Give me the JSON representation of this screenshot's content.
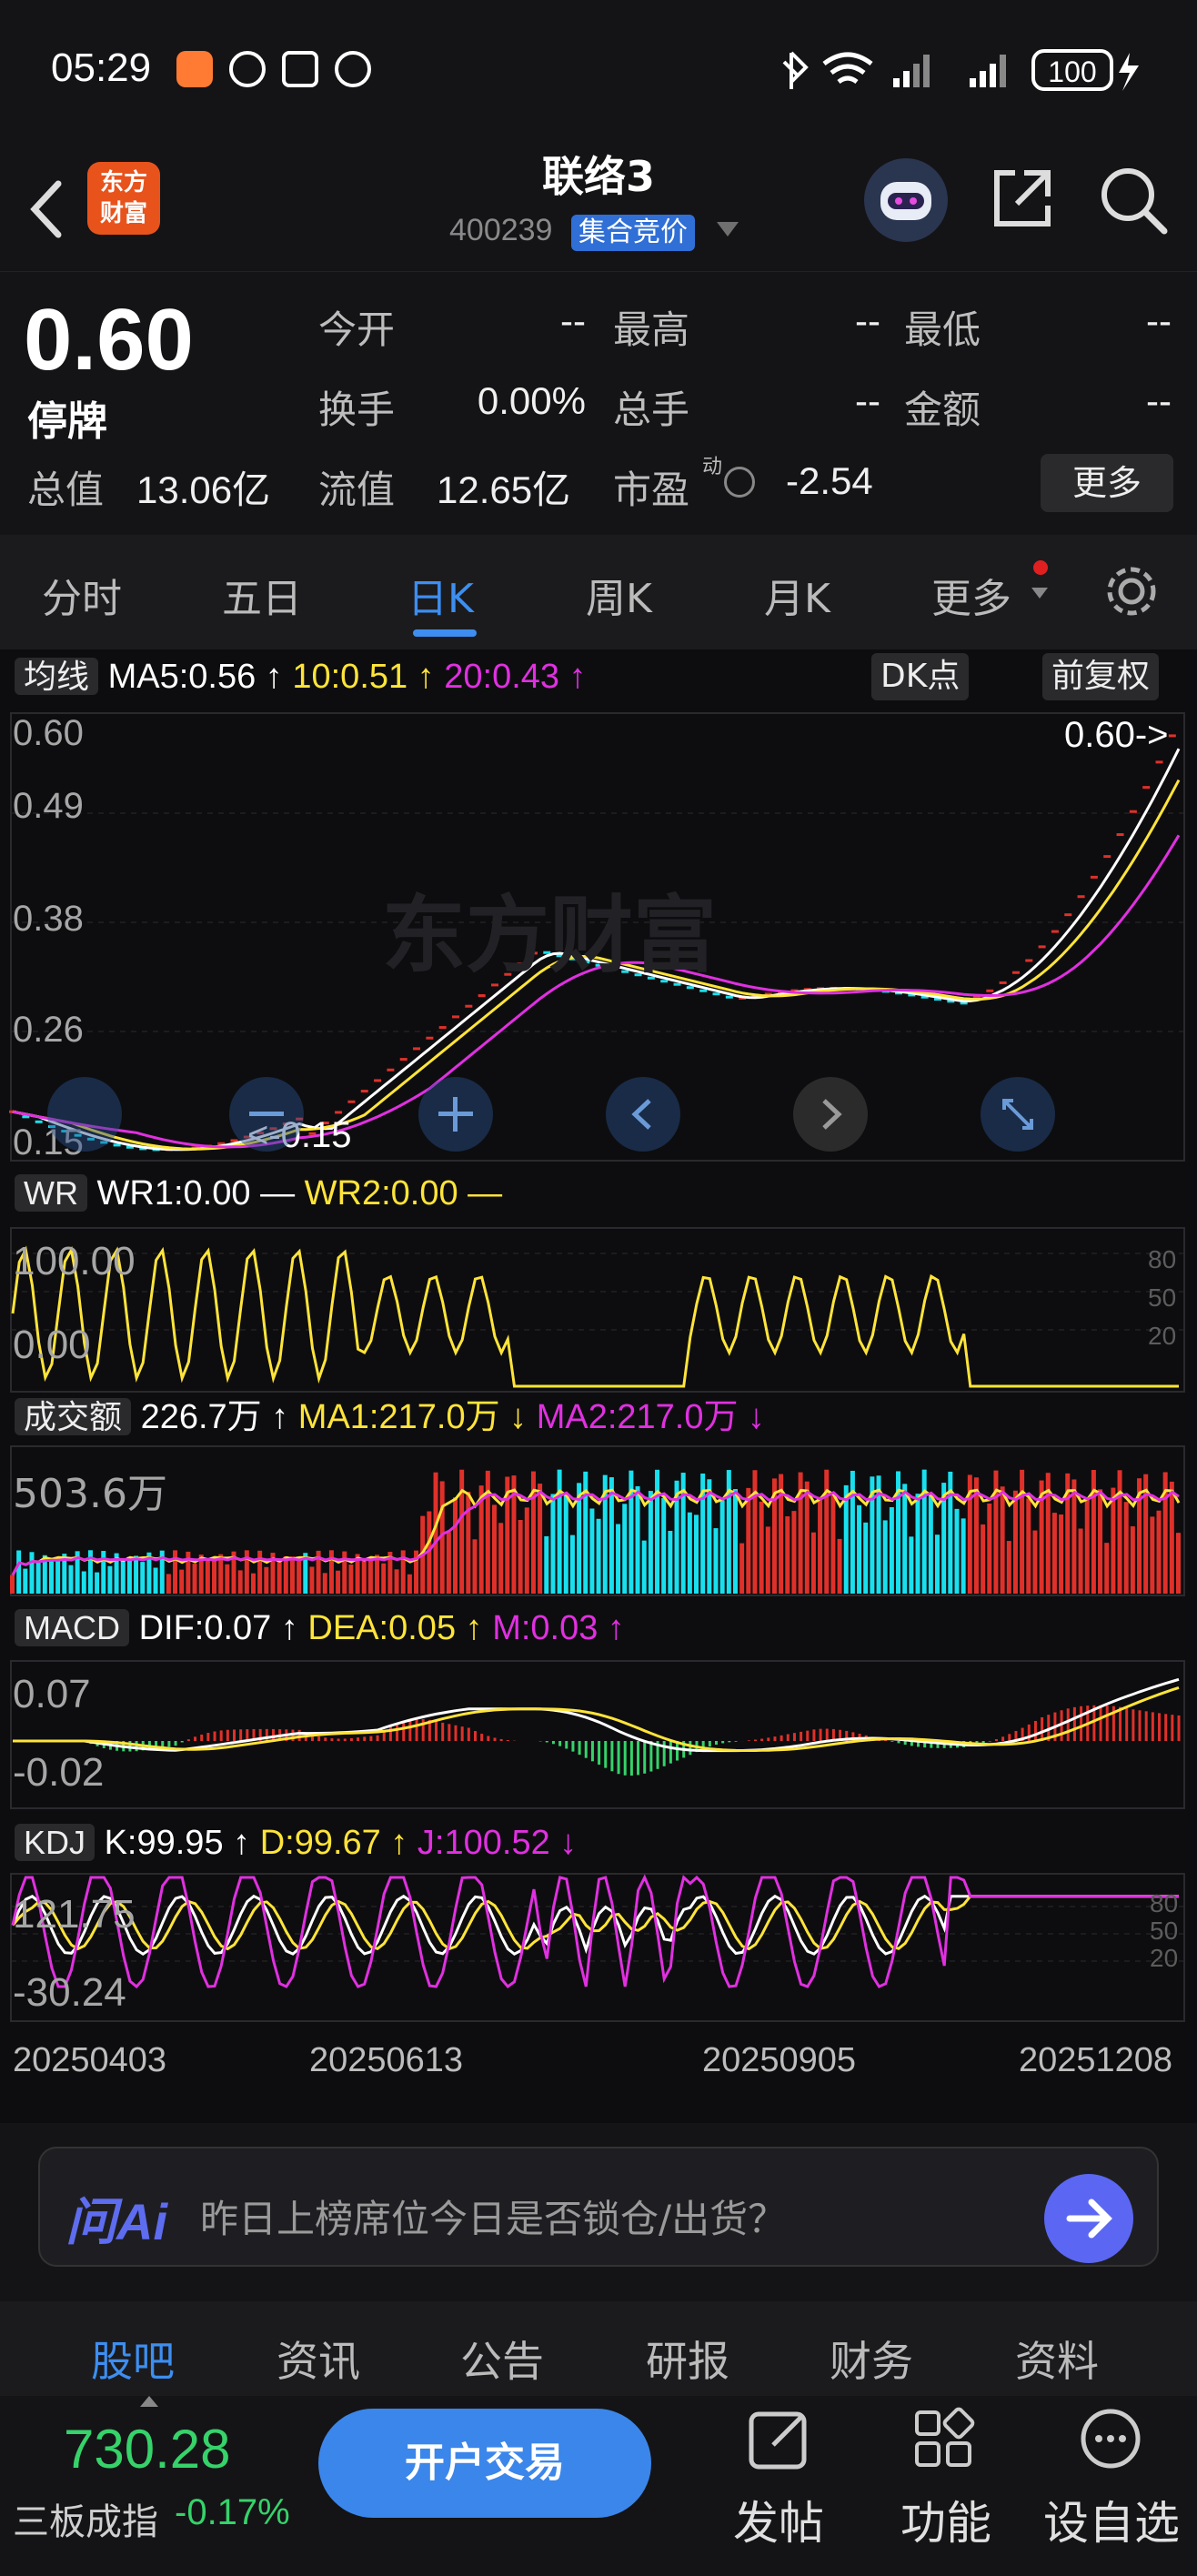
{
  "status": {
    "time": "05:29",
    "battery": "100"
  },
  "header": {
    "title": "联络3",
    "code": "400239",
    "badge": "集合竞价",
    "logo_text": [
      "东方",
      "财富"
    ]
  },
  "quote": {
    "price": "0.60",
    "state": "停牌",
    "rows": [
      [
        {
          "l": "今开",
          "v": "--"
        },
        {
          "l": "最高",
          "v": "--"
        },
        {
          "l": "最低",
          "v": "--"
        }
      ],
      [
        {
          "l": "换手",
          "v": "0.00%"
        },
        {
          "l": "总手",
          "v": "--"
        },
        {
          "l": "金额",
          "v": "--"
        }
      ]
    ],
    "total_label": "总值",
    "total_value": "13.06亿",
    "float_label": "流值",
    "float_value": "12.65亿",
    "pe_label": "市盈",
    "pe_sup": "动",
    "pe_value": "-2.54",
    "more_label": "更多"
  },
  "tabs": [
    "分时",
    "五日",
    "日K",
    "周K",
    "月K",
    "更多"
  ],
  "active_tab": "日K",
  "main_chart": {
    "indicator": "均线",
    "ma5": "MA5:0.56 ↑",
    "ma10": "10:0.51 ↑",
    "ma20": "20:0.43 ↑",
    "dk_label": "DK点",
    "adj_label": "前复权",
    "y_labels": [
      "0.60",
      "0.49",
      "0.38",
      "0.26",
      "0.15"
    ],
    "last_price_tag": "0.60->",
    "low_tag": "<-0.15",
    "watermark": "东方财富"
  },
  "wr_panel": {
    "name": "WR",
    "wr1": "WR1:0.00 —",
    "wr2": "WR2:0.00 —",
    "y_labels": [
      "100.00",
      "0.00"
    ],
    "right_labels": [
      "80",
      "50",
      "20"
    ]
  },
  "vol_panel": {
    "name": "成交额",
    "val": "226.7万 ↑",
    "ma1": "MA1:217.0万 ↓",
    "ma2": "MA2:217.0万 ↓",
    "y_label": "503.6万"
  },
  "macd_panel": {
    "name": "MACD",
    "dif": "DIF:0.07 ↑",
    "dea": "DEA:0.05 ↑",
    "m": "M:0.03 ↑",
    "y_labels": [
      "0.07",
      "-0.02"
    ]
  },
  "kdj_panel": {
    "name": "KDJ",
    "k": "K:99.95 ↑",
    "d": "D:99.67 ↑",
    "j": "J:100.52 ↓",
    "y_labels": [
      "121.75",
      "-30.24"
    ],
    "right_labels": [
      "80",
      "50",
      "20"
    ]
  },
  "dates": [
    "20250403",
    "20250613",
    "20250905",
    "20251208"
  ],
  "ask": {
    "ai_label": "问Ai",
    "question": "昨日上榜席位今日是否锁仓/出货？"
  },
  "bottom_tabs": [
    "股吧",
    "资讯",
    "公告",
    "研报",
    "财务",
    "资料"
  ],
  "active_bottom_tab": "股吧",
  "footer": {
    "index_value": "730.28",
    "index_name": "三板成指",
    "index_change": "-0.17%",
    "trade_label": "开户交易",
    "post_label": "发帖",
    "func_label": "功能",
    "fav_label": "设自选"
  },
  "colors": {
    "red": "#e0302a",
    "green": "#36d26a",
    "cyan": "#18e0ee",
    "yellow": "#ffe43a",
    "magenta": "#e030e0",
    "accent": "#3d8ef0"
  }
}
